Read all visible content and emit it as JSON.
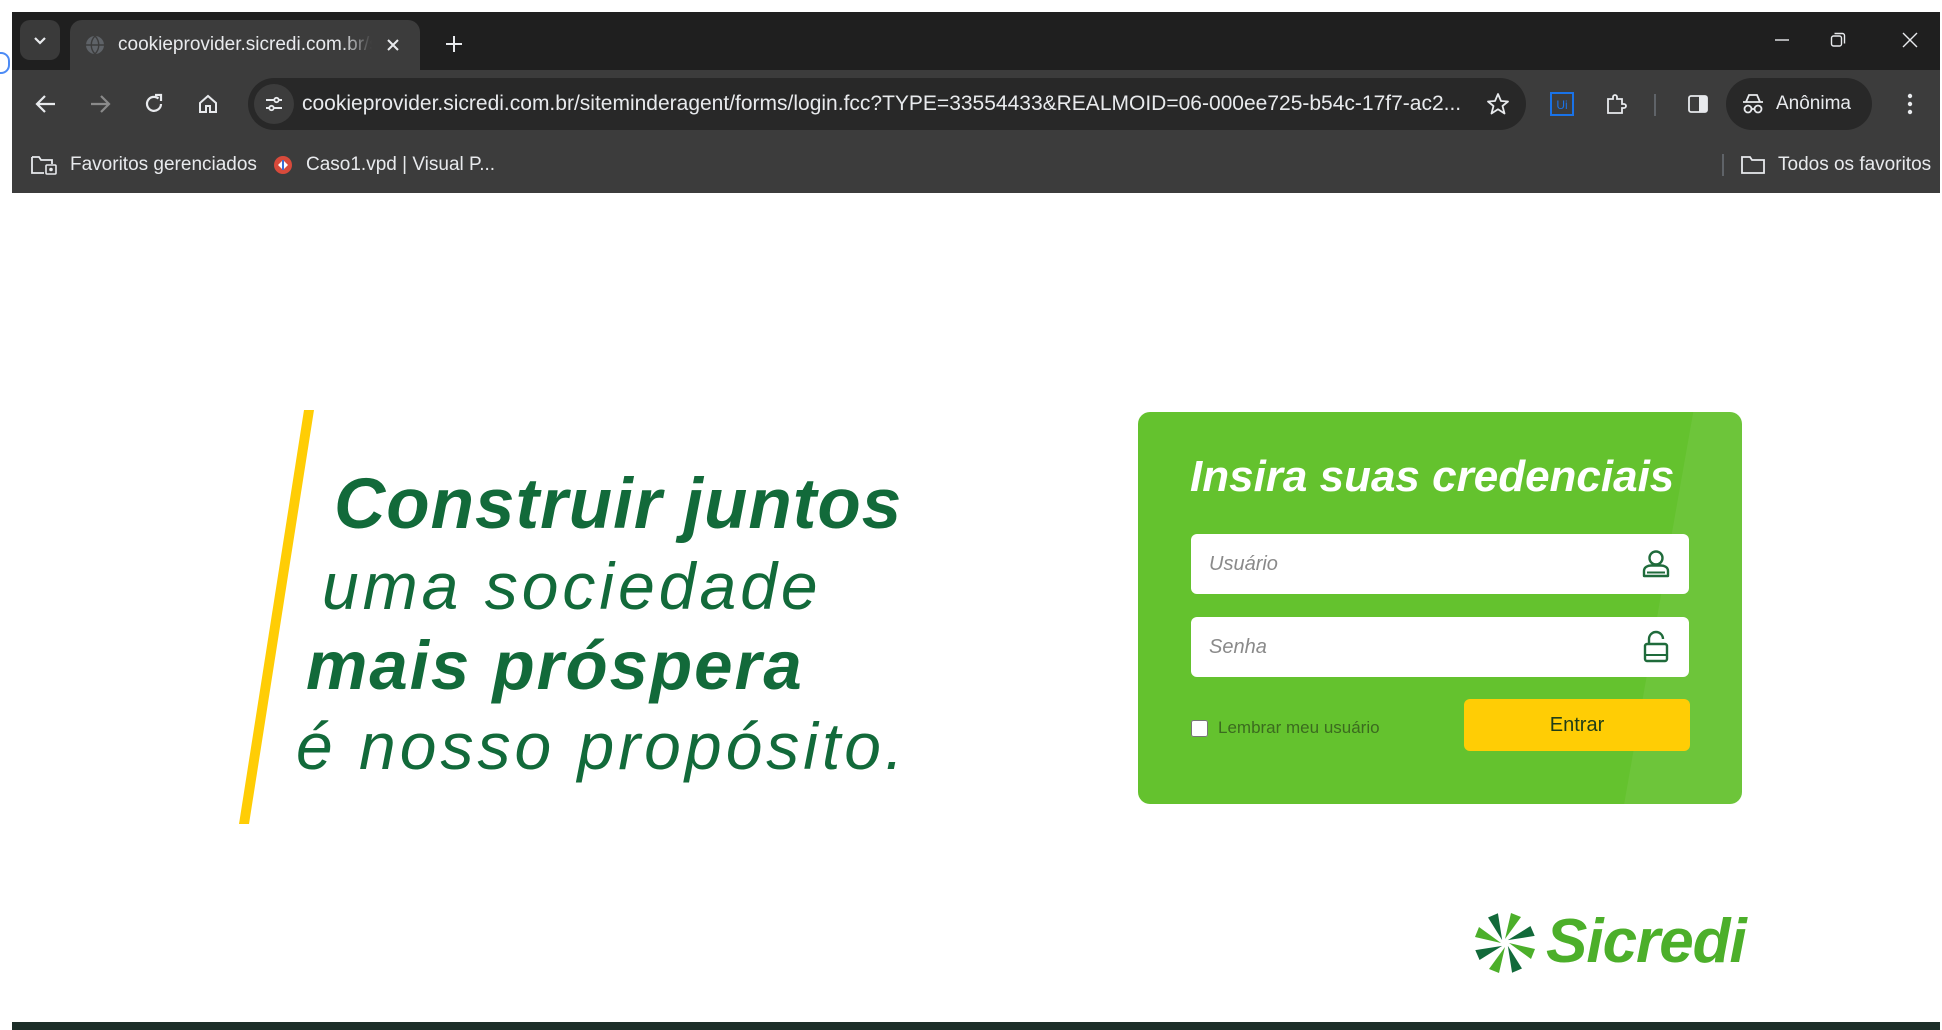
{
  "browser": {
    "tab_title": "cookieprovider.sicredi.com.br/siteminderagent/forms/login.fcc",
    "url": "cookieprovider.sicredi.com.br/siteminderagent/forms/login.fcc?TYPE=33554433&REALMOID=06-000ee725-b54c-17f7-ac2...",
    "profile_label": "Anônima",
    "bookmarks": {
      "managed": "Favoritos gerenciados",
      "caso": "Caso1.vpd | Visual P...",
      "all": "Todos os favoritos"
    }
  },
  "hero": {
    "line1": "Construir juntos",
    "line2": "uma sociedade",
    "line3": "mais próspera",
    "line4": "é nosso propósito."
  },
  "login": {
    "title": "Insira suas credenciais",
    "username_placeholder": "Usuário",
    "password_placeholder": "Senha",
    "remember_label": "Lembrar meu usuário",
    "submit_label": "Entrar"
  },
  "brand": {
    "name": "Sicredi"
  },
  "colors": {
    "card_green": "#64c22e",
    "slogan_green": "#126a3a",
    "accent_yellow": "#ffcd05",
    "logo_green": "#4caf2a"
  },
  "icons": [
    "tab-search-icon",
    "globe-icon",
    "close-icon",
    "plus-icon",
    "minimize-icon",
    "restore-icon",
    "window-close-icon",
    "back-icon",
    "forward-icon",
    "reload-icon",
    "home-icon",
    "site-info-icon",
    "star-icon",
    "uipath-extension-icon",
    "puzzle-extension-icon",
    "side-panel-icon",
    "incognito-icon",
    "more-vert-icon",
    "managed-folder-icon",
    "bookmark-favicon",
    "folder-icon",
    "user-icon",
    "lock-icon",
    "sicredi-logo-icon"
  ]
}
